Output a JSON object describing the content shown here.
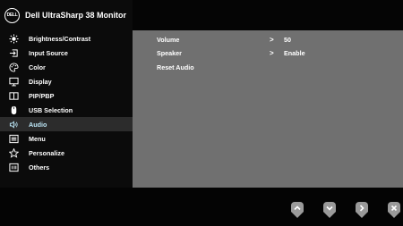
{
  "header": {
    "logo_text": "DELL",
    "title": "Dell UltraSharp 38 Monitor"
  },
  "menu": {
    "items": [
      {
        "label": "Brightness/Contrast",
        "icon": "brightness-icon"
      },
      {
        "label": "Input Source",
        "icon": "input-source-icon"
      },
      {
        "label": "Color",
        "icon": "color-palette-icon"
      },
      {
        "label": "Display",
        "icon": "display-icon"
      },
      {
        "label": "PIP/PBP",
        "icon": "pip-pbp-icon"
      },
      {
        "label": "USB Selection",
        "icon": "mouse-icon"
      },
      {
        "label": "Audio",
        "icon": "speaker-icon",
        "active": true
      },
      {
        "label": "Menu",
        "icon": "menu-icon"
      },
      {
        "label": "Personalize",
        "icon": "star-icon"
      },
      {
        "label": "Others",
        "icon": "others-icon"
      }
    ]
  },
  "audio": {
    "rows": [
      {
        "label": "Volume",
        "value": ">",
        "setting": "50"
      },
      {
        "label": "Speaker",
        "value": ">",
        "setting": "Enable"
      },
      {
        "label": "Reset Audio",
        "value": "",
        "setting": ""
      }
    ]
  },
  "nav": {
    "buttons": [
      {
        "icon": "chevron-up-icon"
      },
      {
        "icon": "chevron-down-icon"
      },
      {
        "icon": "chevron-right-icon"
      },
      {
        "icon": "close-icon"
      }
    ]
  },
  "colors": {
    "active_text": "#bde7f7",
    "active_bg": "#2c2c2c",
    "content_bg": "#707070"
  }
}
